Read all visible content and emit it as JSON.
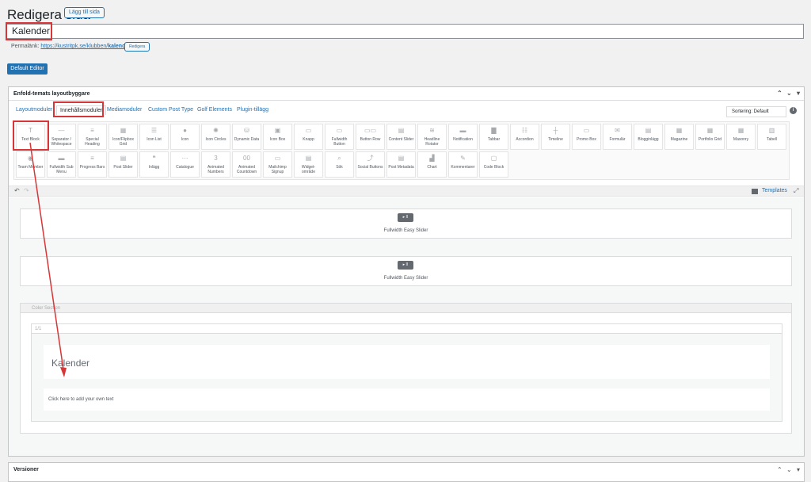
{
  "header": {
    "title": "Redigera sida",
    "add_page": "Lägg till sida"
  },
  "post": {
    "title_value": "Kalender",
    "permalink_label": "Permalänk:",
    "permalink_base": "https://kustritpk.se/klubben/",
    "permalink_slug": "kalender",
    "permalink_end": "/",
    "edit_button": "Redigera"
  },
  "editor_toggle": "Default Editor",
  "builder": {
    "title": "Enfold-temats layoutbyggare",
    "tabs": [
      "Layoutmoduler",
      "Innehållsmoduler",
      "Mediamoduler",
      "Custom Post Type",
      "Golf Elements",
      "Plugin-tillägg"
    ],
    "sort_label": "Sortering: Default",
    "info_icon": "i",
    "row1": [
      {
        "label": "Text Block",
        "icon": "T"
      },
      {
        "label": "Separator / Whitespace",
        "icon": "—"
      },
      {
        "label": "Special Heading",
        "icon": "≡"
      },
      {
        "label": "Icon/Flipbox Grid",
        "icon": "▦"
      },
      {
        "label": "Icon List",
        "icon": "☰"
      },
      {
        "label": "Icon",
        "icon": "●"
      },
      {
        "label": "Icon Circles",
        "icon": "✺"
      },
      {
        "label": "Dynamic Data",
        "icon": "⛁"
      },
      {
        "label": "Icon Box",
        "icon": "▣"
      },
      {
        "label": "Knapp",
        "icon": "▭"
      },
      {
        "label": "Fullwidth Button",
        "icon": "▭"
      },
      {
        "label": "Button Row",
        "icon": "▭▭"
      },
      {
        "label": "Content Slider",
        "icon": "▤"
      },
      {
        "label": "Headline Rotator",
        "icon": "≋"
      },
      {
        "label": "Notification",
        "icon": "▬"
      },
      {
        "label": "Tabbar",
        "icon": "▇"
      },
      {
        "label": "Accordion",
        "icon": "☷"
      },
      {
        "label": "Timeline",
        "icon": "┼"
      },
      {
        "label": "Promo Box",
        "icon": "▭"
      },
      {
        "label": "Formulär",
        "icon": "✉"
      },
      {
        "label": "Blogginlägg",
        "icon": "▤"
      },
      {
        "label": "Magazine",
        "icon": "▦"
      },
      {
        "label": "Portfolio Grid",
        "icon": "▦"
      },
      {
        "label": "Masonry",
        "icon": "▦"
      },
      {
        "label": "Tabell",
        "icon": "▥"
      }
    ],
    "row2": [
      {
        "label": "Team Member",
        "icon": "◉"
      },
      {
        "label": "Fullwidth Sub Menu",
        "icon": "▬"
      },
      {
        "label": "Progress Bars",
        "icon": "≡"
      },
      {
        "label": "Post Slider",
        "icon": "▤"
      },
      {
        "label": "Inlägg",
        "icon": "❝"
      },
      {
        "label": "Catalogue",
        "icon": "⋯"
      },
      {
        "label": "Animated Numbers",
        "icon": "3"
      },
      {
        "label": "Animated Countdown",
        "icon": "00"
      },
      {
        "label": "Mailchimp Signup",
        "icon": "▭"
      },
      {
        "label": "Widget-område",
        "icon": "▤"
      },
      {
        "label": "Sök",
        "icon": "⌕"
      },
      {
        "label": "Social Buttons",
        "icon": "⤴"
      },
      {
        "label": "Post Metadata",
        "icon": "▤"
      },
      {
        "label": "Chart",
        "icon": "▟"
      },
      {
        "label": "Kommentarer",
        "icon": "✎"
      },
      {
        "label": "Code Block",
        "icon": "▢"
      }
    ],
    "undo_icon": "↶",
    "redo_icon": "↷",
    "templates_label": "Templates",
    "expand_icon": "⤢"
  },
  "canvas": {
    "slider1_label": "Fullwidth Easy Slider",
    "slider2_label": "Fullwidth Easy Slider",
    "slider_icon": "▸ II",
    "color_section_label": "Color Section",
    "column_label": "1/1",
    "heading_text": "Kalender",
    "text_placeholder": "Click here to add your own text"
  },
  "versioner": {
    "title": "Versioner"
  }
}
